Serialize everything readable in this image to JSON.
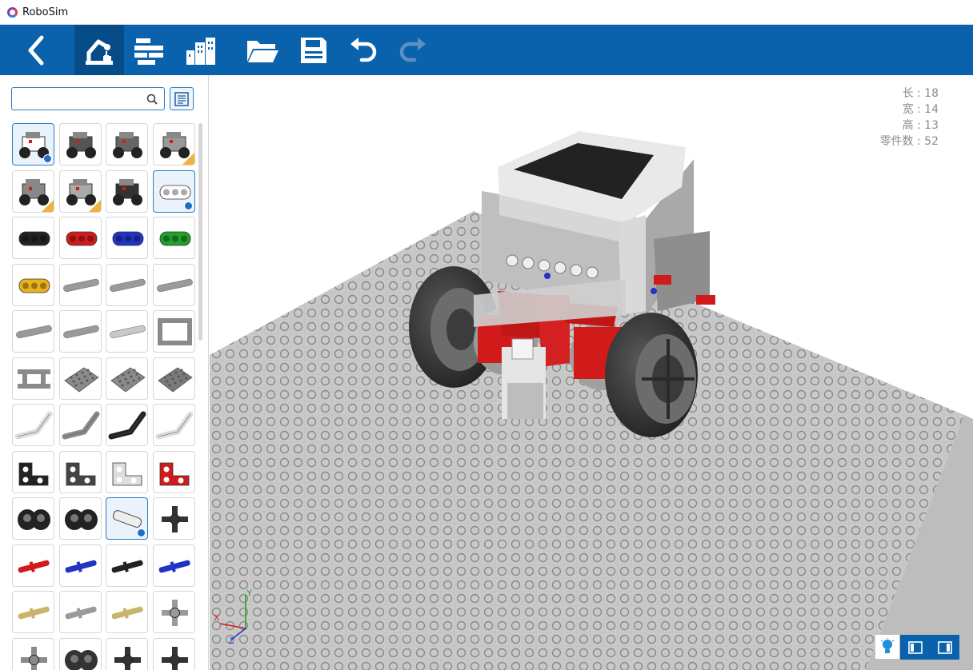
{
  "window": {
    "title": "RoboSim"
  },
  "toolbar": {
    "buttons": [
      {
        "name": "back",
        "icon": "chevron-left-icon"
      },
      {
        "name": "build",
        "icon": "robot-arm-icon",
        "active": true
      },
      {
        "name": "steps",
        "icon": "assembly-steps-icon"
      },
      {
        "name": "scene",
        "icon": "buildings-icon"
      },
      {
        "name": "open",
        "icon": "folder-icon"
      },
      {
        "name": "save",
        "icon": "save-icon"
      },
      {
        "name": "undo",
        "icon": "undo-icon"
      },
      {
        "name": "redo",
        "icon": "redo-icon",
        "disabled": true
      }
    ],
    "colors": {
      "bar": "#0a62ad",
      "active": "#064c88"
    }
  },
  "sidebar": {
    "search": {
      "value": "",
      "placeholder": ""
    },
    "catalog_icon": "catalog-list-icon",
    "parts": [
      {
        "kind": "robot",
        "color": "#ffffff",
        "selected": true,
        "badge": true
      },
      {
        "kind": "robot",
        "color": "#555555"
      },
      {
        "kind": "robot",
        "color": "#666666"
      },
      {
        "kind": "robot",
        "color": "#999999",
        "corner": true
      },
      {
        "kind": "robot",
        "color": "#888888",
        "corner": true
      },
      {
        "kind": "robot",
        "color": "#aaaaaa",
        "corner": true
      },
      {
        "kind": "robot",
        "color": "#333333"
      },
      {
        "kind": "beam3",
        "color": "#ffffff",
        "selected": true,
        "badge": true
      },
      {
        "kind": "beam3",
        "color": "#222222"
      },
      {
        "kind": "beam3",
        "color": "#d11b1b"
      },
      {
        "kind": "beam3",
        "color": "#2233c4"
      },
      {
        "kind": "beam3",
        "color": "#22a02c"
      },
      {
        "kind": "beam3",
        "color": "#e8b21c"
      },
      {
        "kind": "beam-long",
        "color": "#9a9a9a"
      },
      {
        "kind": "beam-long",
        "color": "#9a9a9a"
      },
      {
        "kind": "beam-long",
        "color": "#9a9a9a"
      },
      {
        "kind": "beam-long",
        "color": "#9a9a9a"
      },
      {
        "kind": "beam-long",
        "color": "#9a9a9a"
      },
      {
        "kind": "beam-long",
        "color": "#c8c8c8"
      },
      {
        "kind": "frame",
        "color": "#8a8a8a"
      },
      {
        "kind": "frame-h",
        "color": "#8a8a8a"
      },
      {
        "kind": "plate",
        "color": "#8a8a8a"
      },
      {
        "kind": "plate",
        "color": "#8a8a8a"
      },
      {
        "kind": "plate",
        "color": "#7a7a7a"
      },
      {
        "kind": "bent",
        "color": "#dddddd"
      },
      {
        "kind": "bent",
        "color": "#8a8a8a"
      },
      {
        "kind": "bent",
        "color": "#222222"
      },
      {
        "kind": "bent",
        "color": "#dddddd"
      },
      {
        "kind": "lbeam",
        "color": "#222222"
      },
      {
        "kind": "lbeam",
        "color": "#444444"
      },
      {
        "kind": "lbeam",
        "color": "#dddddd"
      },
      {
        "kind": "lbeam",
        "color": "#d11b1b"
      },
      {
        "kind": "connector",
        "color": "#222222"
      },
      {
        "kind": "connector",
        "color": "#222222"
      },
      {
        "kind": "axle-conn",
        "color": "#ffffff",
        "selected": true,
        "badge": true
      },
      {
        "kind": "cross",
        "color": "#333333"
      },
      {
        "kind": "pin",
        "color": "#d11b1b"
      },
      {
        "kind": "pin",
        "color": "#2233c4"
      },
      {
        "kind": "pin",
        "color": "#222222"
      },
      {
        "kind": "pin",
        "color": "#2233c4"
      },
      {
        "kind": "pin",
        "color": "#c8b46a"
      },
      {
        "kind": "pin",
        "color": "#9a9a9a"
      },
      {
        "kind": "pin",
        "color": "#c8b46a"
      },
      {
        "kind": "cross",
        "color": "#9a9a9a"
      },
      {
        "kind": "cross",
        "color": "#8a8a8a"
      },
      {
        "kind": "connector",
        "color": "#333333"
      },
      {
        "kind": "cross",
        "color": "#333333"
      },
      {
        "kind": "cross",
        "color": "#333333"
      }
    ]
  },
  "viewport": {
    "dimensions": {
      "length": "长 : 18",
      "width": "宽 : 14",
      "height": "高 : 13",
      "part_count": "零件数 : 52"
    },
    "axes": {
      "y": "Y",
      "x": "X",
      "z": "Z",
      "colors": {
        "y": "#1aa01a",
        "x": "#d21a1a",
        "z": "#1a3cc8"
      }
    },
    "controls": {
      "light_icon": "lightbulb-icon",
      "view_left_icon": "panel-left-icon",
      "view_right_icon": "panel-right-icon"
    }
  }
}
